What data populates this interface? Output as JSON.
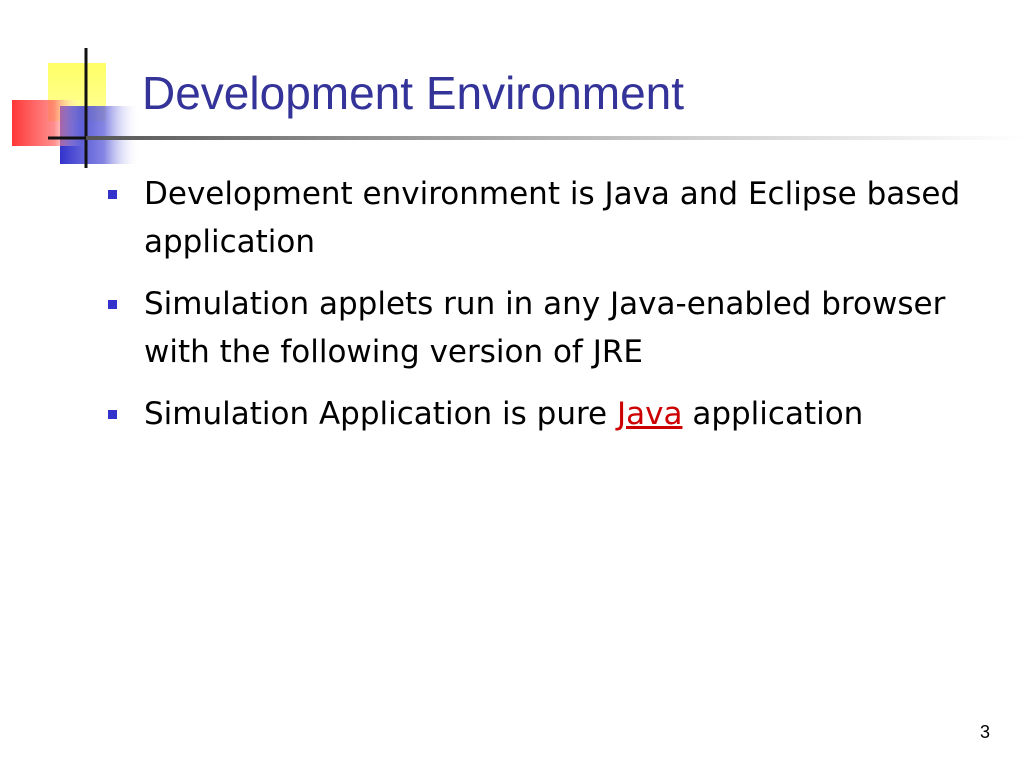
{
  "slide": {
    "title": "Development Environment",
    "bullets": [
      {
        "text": "Development environment is Java and Eclipse based application"
      },
      {
        "text": "Simulation applets run in any Java-enabled browser with the following version of JRE"
      },
      {
        "text_before": "Simulation Application is pure ",
        "link_text": "Java",
        "text_after": " application"
      }
    ],
    "page_number": "3"
  },
  "colors": {
    "title": "#333399",
    "bullet_marker": "#3333cc",
    "link": "#cc0000",
    "logo_yellow": "#ffff66",
    "logo_red": "#ff3333",
    "logo_blue": "#3333cc"
  },
  "icons": {
    "logo": "square-blocks-logo",
    "bullet": "square-bullet-icon"
  }
}
